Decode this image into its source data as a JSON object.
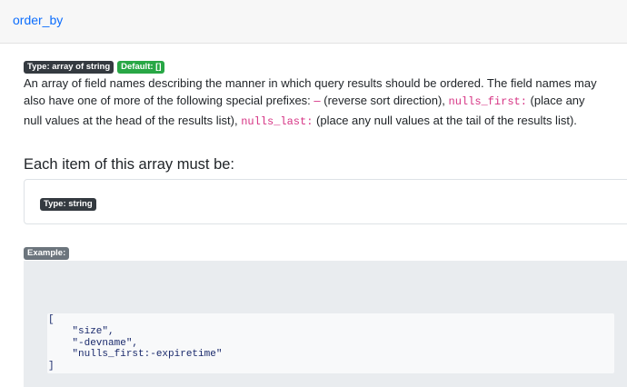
{
  "property": {
    "name": "order_by"
  },
  "badges": {
    "type": "Type: array of string",
    "default": "Default: []"
  },
  "description": {
    "text1": "An array of field names describing the manner in which query results should be ordered. The field names may also have one of more of the following special prefixes: ",
    "dash": "–",
    "text2": " (reverse sort direction), ",
    "code1": "nulls_first:",
    "text3": " (place any null values at the head of the results list), ",
    "code2": "nulls_last:",
    "text4": " (place any null values at the tail of the results list)."
  },
  "items": {
    "heading": "Each item of this array must be:",
    "type_badge": "Type: string"
  },
  "example": {
    "badge": "Example:",
    "code": "[\n    \"size\",\n    \"-devname\",\n    \"nulls_first:-expiretime\"\n]"
  }
}
